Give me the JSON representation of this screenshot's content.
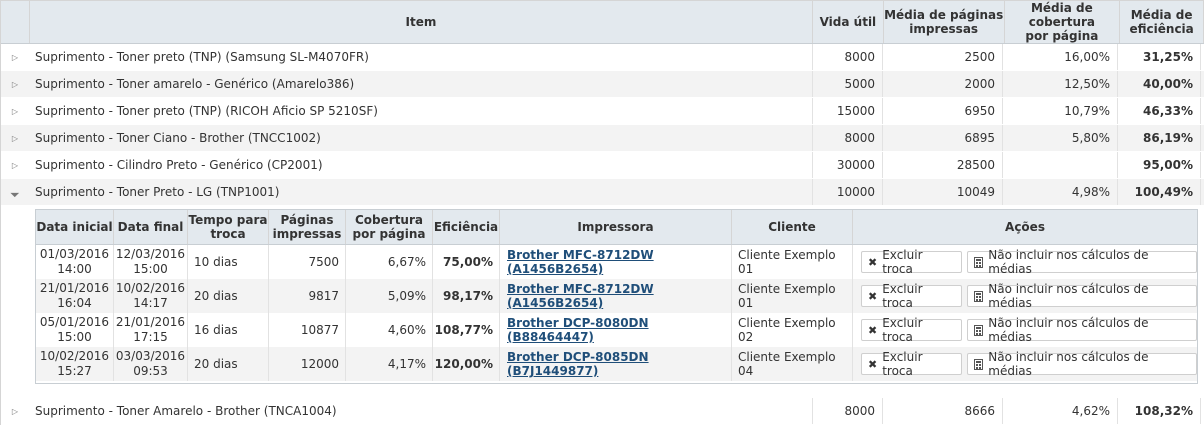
{
  "header": {
    "item": "Item",
    "vida_util": "Vida útil",
    "media_paginas_l1": "Média de páginas",
    "media_paginas_l2": "impressas",
    "media_cobertura_l1": "Média de cobertura",
    "media_cobertura_l2": "por página",
    "media_eficiencia_l1": "Média de",
    "media_eficiencia_l2": "eficiência"
  },
  "rows": [
    {
      "item": "Suprimento - Toner preto (TNP) (Samsung SL-M4070FR)",
      "vida": "8000",
      "media": "2500",
      "cob": "16,00%",
      "eff": "31,25%"
    },
    {
      "item": "Suprimento - Toner amarelo - Genérico (Amarelo386)",
      "vida": "5000",
      "media": "2000",
      "cob": "12,50%",
      "eff": "40,00%"
    },
    {
      "item": "Suprimento - Toner preto (TNP) (RICOH Aficio SP 5210SF)",
      "vida": "15000",
      "media": "6950",
      "cob": "10,79%",
      "eff": "46,33%"
    },
    {
      "item": "Suprimento - Toner Ciano - Brother (TNCC1002)",
      "vida": "8000",
      "media": "6895",
      "cob": "5,80%",
      "eff": "86,19%"
    },
    {
      "item": "Suprimento - Cilindro Preto - Genérico (CP2001)",
      "vida": "30000",
      "media": "28500",
      "cob": "",
      "eff": "95,00%"
    },
    {
      "item": "Suprimento - Toner Preto - LG (TNP1001)",
      "vida": "10000",
      "media": "10049",
      "cob": "4,98%",
      "eff": "100,49%"
    }
  ],
  "last_row": {
    "item": "Suprimento - Toner Amarelo - Brother (TNCA1004)",
    "vida": "8000",
    "media": "8666",
    "cob": "4,62%",
    "eff": "108,32%"
  },
  "detail": {
    "header": {
      "data_inicial": "Data inicial",
      "data_final": "Data final",
      "tempo_l1": "Tempo para",
      "tempo_l2": "troca",
      "paginas_l1": "Páginas",
      "paginas_l2": "impressas",
      "cobertura_l1": "Cobertura",
      "cobertura_l2": "por página",
      "eficiencia": "Eficiência",
      "impressora": "Impressora",
      "cliente": "Cliente",
      "acoes": "Ações"
    },
    "rows": [
      {
        "ini_d": "01/03/2016",
        "ini_t": "14:00",
        "fim_d": "12/03/2016",
        "fim_t": "15:00",
        "tempo": "10 dias",
        "paginas": "7500",
        "cob": "6,67%",
        "eff": "75,00%",
        "impressora": "Brother MFC-8712DW (A1456B2654)",
        "cliente": "Cliente Exemplo 01"
      },
      {
        "ini_d": "21/01/2016",
        "ini_t": "16:04",
        "fim_d": "10/02/2016",
        "fim_t": "14:17",
        "tempo": "20 dias",
        "paginas": "9817",
        "cob": "5,09%",
        "eff": "98,17%",
        "impressora": "Brother MFC-8712DW (A1456B2654)",
        "cliente": "Cliente Exemplo 01"
      },
      {
        "ini_d": "05/01/2016",
        "ini_t": "15:00",
        "fim_d": "21/01/2016",
        "fim_t": "17:15",
        "tempo": "16 dias",
        "paginas": "10877",
        "cob": "4,60%",
        "eff": "108,77%",
        "impressora": "Brother DCP-8080DN (B88464447)",
        "cliente": "Cliente Exemplo 02"
      },
      {
        "ini_d": "10/02/2016",
        "ini_t": "15:27",
        "fim_d": "03/03/2016",
        "fim_t": "09:53",
        "tempo": "20 dias",
        "paginas": "12000",
        "cob": "4,17%",
        "eff": "120,00%",
        "impressora": "Brother DCP-8085DN (B7J1449877)",
        "cliente": "Cliente Exemplo 04"
      }
    ],
    "actions": {
      "excluir": "Excluir troca",
      "nao_incluir": "Não incluir nos cálculos de médias"
    }
  },
  "icons": {
    "collapsed": "caret-right-icon",
    "expanded": "caret-down-icon",
    "excluir": "x-icon",
    "nao_incluir": "calculator-icon"
  },
  "colors": {
    "header_bg": "#e3e9ee",
    "alt_row": "#f3f3f3",
    "link": "#1f4e79"
  }
}
